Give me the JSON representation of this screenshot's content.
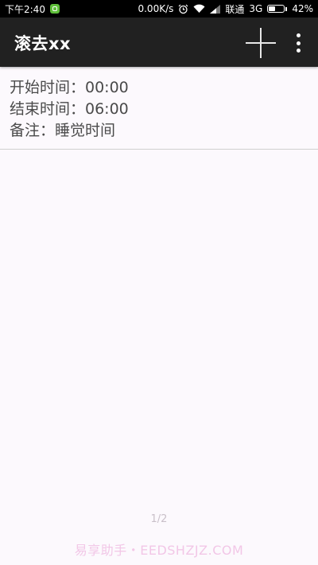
{
  "status_bar": {
    "time": "下午2:40",
    "network_speed": "0.00K/s",
    "carrier": "联通",
    "network_type": "3G",
    "battery_percent": "42%",
    "battery_level": 0.42,
    "icons": [
      "app-notification-icon",
      "alarm-icon",
      "wifi-icon",
      "signal-icon",
      "battery-icon"
    ]
  },
  "toolbar": {
    "title": "滚去xx",
    "actions": [
      "add-icon",
      "more-vert-icon"
    ],
    "background": "#212121"
  },
  "list": {
    "items": [
      {
        "start_line": "开始时间：00:00",
        "end_line": "结束时间：06:00",
        "note_line": "备注：睡觉时间"
      }
    ]
  },
  "page_indicator": "1/2",
  "watermark": "易享助手・EEDSHZJZ.COM"
}
